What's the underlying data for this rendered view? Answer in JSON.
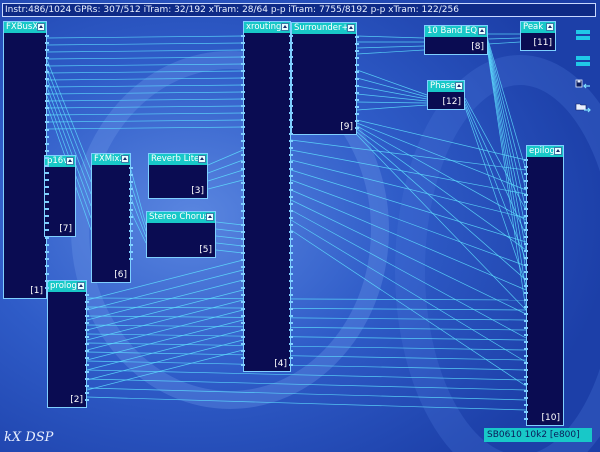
{
  "status": {
    "text": "Instr:486/1024 GPRs: 307/512 iTram: 32/192 xTram: 28/64 p-p iTram: 7755/8192 p-p xTram: 122/256"
  },
  "blocks": [
    {
      "key": "fxbusx",
      "title": "FXBusX",
      "id": "[1]"
    },
    {
      "key": "p16v",
      "title": "p16v",
      "id": "[7]"
    },
    {
      "key": "fxmix2",
      "title": "FXMix2",
      "id": "[6]"
    },
    {
      "key": "reverb",
      "title": "Reverb Lite",
      "id": "[3]"
    },
    {
      "key": "chorus",
      "title": "Stereo Chorus",
      "id": "[5]"
    },
    {
      "key": "prolog",
      "title": "prolog",
      "id": "[2]"
    },
    {
      "key": "xrouting",
      "title": "xrouting",
      "id": "[4]"
    },
    {
      "key": "surrounder",
      "title": "Surrounder+",
      "id": "[9]"
    },
    {
      "key": "eq",
      "title": "10 Band EQ",
      "id": "[8]"
    },
    {
      "key": "peak",
      "title": "Peak",
      "id": "[11]"
    },
    {
      "key": "phase",
      "title": "Phase",
      "id": "[12]"
    },
    {
      "key": "epilog",
      "title": "epilog",
      "id": "[10]"
    }
  ],
  "logo": "kX DSP",
  "footer": "SB0610 10k2 [e800]",
  "colors": {
    "background": "#2a55c8",
    "block_body": "#0a0c52",
    "block_title": "#18c8c8",
    "wire": "#5fe0ff"
  },
  "icons": [
    "menu-icon",
    "menu-icon",
    "save-icon",
    "load-icon"
  ]
}
